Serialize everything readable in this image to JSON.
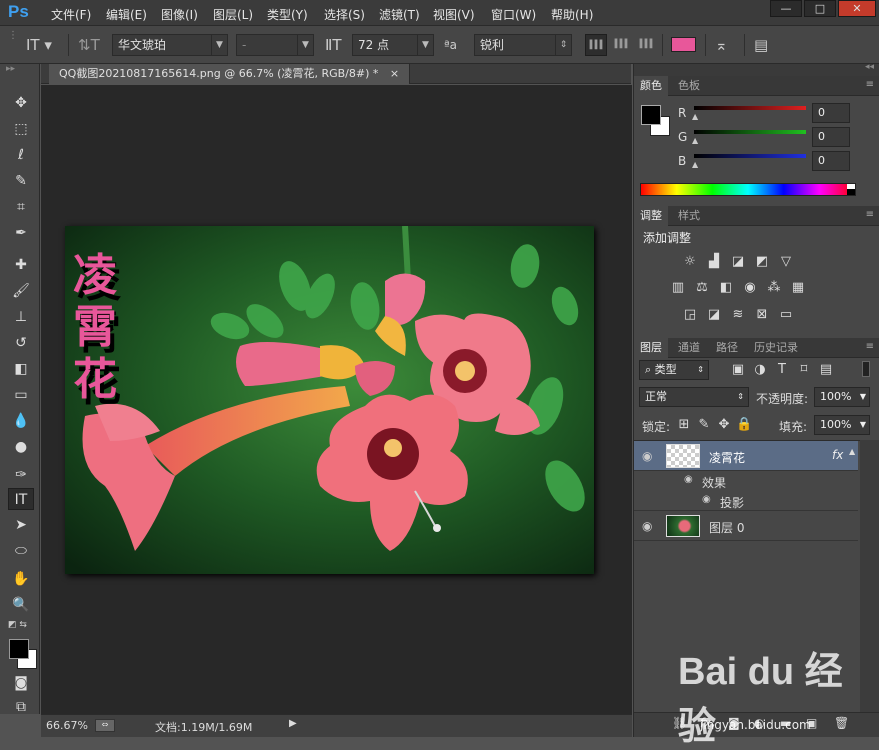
{
  "app": {
    "logo": "Ps"
  },
  "menu": [
    "文件(F)",
    "编辑(E)",
    "图像(I)",
    "图层(L)",
    "类型(Y)",
    "选择(S)",
    "滤镜(T)",
    "视图(V)",
    "窗口(W)",
    "帮助(H)"
  ],
  "window_buttons": [
    "—",
    "□",
    "✕"
  ],
  "options": {
    "font_family": "华文琥珀",
    "font_style": "-",
    "font_size": "72 点",
    "aa_label": "ªa",
    "antialias": "锐利",
    "text_color": "#e8579a"
  },
  "document": {
    "tab_title": "QQ截图20210817165614.png @ 66.7% (凌霄花, RGB/8#) *",
    "close": "×",
    "vertical_text": [
      "凌",
      "霄",
      "花"
    ]
  },
  "status": {
    "zoom": "66.67%",
    "doc_info": "文档:1.19M/1.69M"
  },
  "color_panel": {
    "tabs": [
      "颜色",
      "色板"
    ],
    "channels": [
      {
        "label": "R",
        "value": "0",
        "color": "#e02020"
      },
      {
        "label": "G",
        "value": "0",
        "color": "#20c020"
      },
      {
        "label": "B",
        "value": "0",
        "color": "#2030e0"
      }
    ]
  },
  "adjust_panel": {
    "tabs": [
      "调整",
      "样式"
    ],
    "title": "添加调整"
  },
  "layers_panel": {
    "tabs": [
      "图层",
      "通道",
      "路径",
      "历史记录"
    ],
    "filter": "类型",
    "blend_mode": "正常",
    "opacity_label": "不透明度:",
    "opacity": "100%",
    "lock_label": "锁定:",
    "fill_label": "填充:",
    "fill": "100%",
    "layers": [
      {
        "name": "凌霄花",
        "fx": "fx",
        "effects_label": "效果",
        "effect": "投影"
      },
      {
        "name": "图层 0"
      }
    ]
  },
  "watermark": {
    "text": "Bai du 经验",
    "url": "jingyan.baidu.com"
  }
}
